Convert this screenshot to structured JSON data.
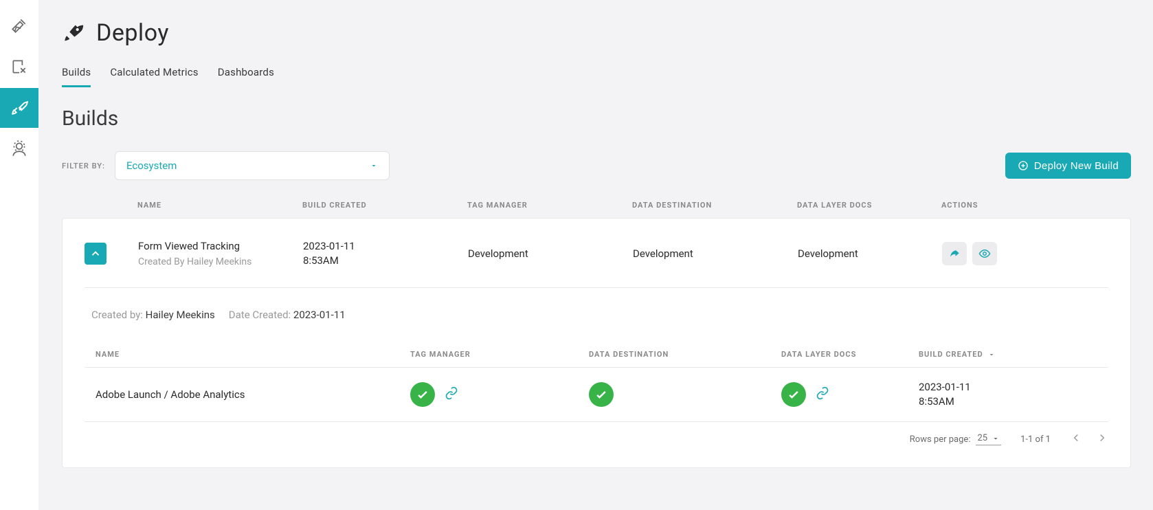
{
  "page": {
    "title": "Deploy"
  },
  "tabs": [
    {
      "label": "Builds",
      "active": true
    },
    {
      "label": "Calculated Metrics",
      "active": false
    },
    {
      "label": "Dashboards",
      "active": false
    }
  ],
  "section": {
    "title": "Builds"
  },
  "filter": {
    "label": "FILTER BY:",
    "value": "Ecosystem"
  },
  "deploy_button": {
    "label": "Deploy New Build"
  },
  "columns": {
    "name": "NAME",
    "build_created": "BUILD CREATED",
    "tag_manager": "TAG MANAGER",
    "data_destination": "DATA DESTINATION",
    "data_layer_docs": "DATA LAYER DOCS",
    "actions": "ACTIONS"
  },
  "builds": [
    {
      "name": "Form Viewed Tracking",
      "created_by_line": "Created By Hailey Meekins",
      "created_at": "2023-01-11 8:53AM",
      "tag_manager": "Development",
      "data_destination": "Development",
      "data_layer_docs": "Development"
    }
  ],
  "details": {
    "created_by_label": "Created by:",
    "created_by_value": "Hailey Meekins",
    "date_label": "Date Created:",
    "date_value": "2023-01-11",
    "sub_columns": {
      "name": "NAME",
      "tag_manager": "TAG MANAGER",
      "data_destination": "DATA DESTINATION",
      "data_layer_docs": "DATA LAYER DOCS",
      "build_created": "BUILD CREATED"
    },
    "rows": [
      {
        "name": "Adobe Launch / Adobe Analytics",
        "created_at": "2023-01-11 8:53AM"
      }
    ]
  },
  "pagination": {
    "rows_label": "Rows per page:",
    "rows_value": "25",
    "range": "1-1 of 1"
  }
}
